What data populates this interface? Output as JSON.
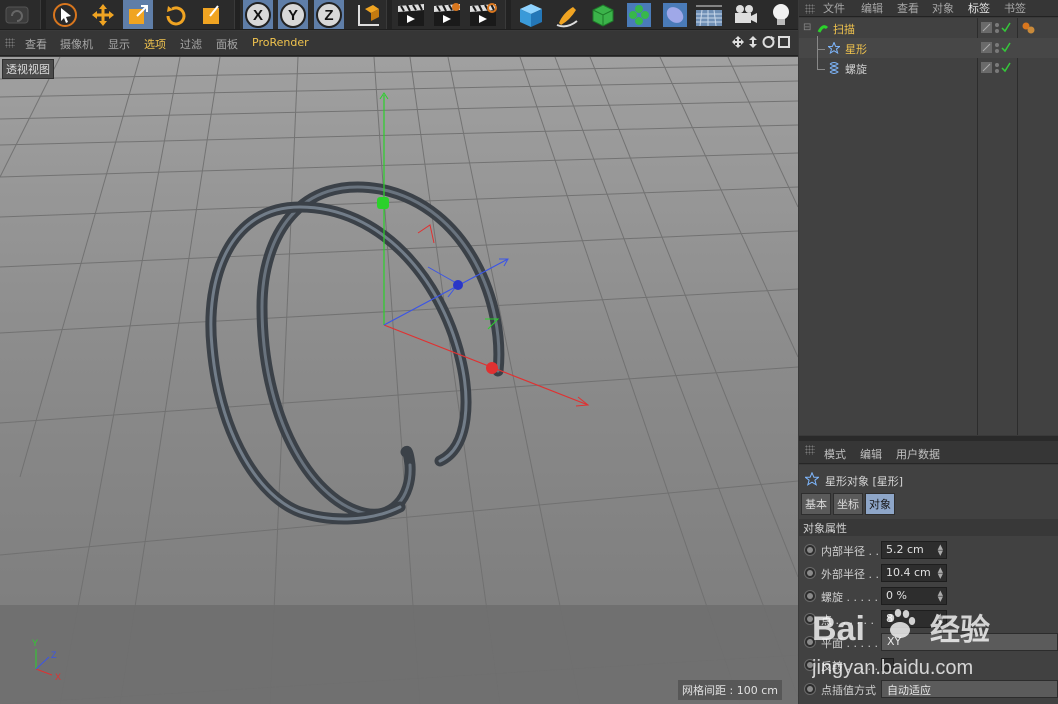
{
  "toolbar": {
    "x_axis": "X",
    "y_axis": "Y",
    "z_axis": "Z"
  },
  "viewport_menu": {
    "items": [
      "查看",
      "摄像机",
      "显示",
      "选项",
      "过滤",
      "面板",
      "ProRender"
    ]
  },
  "viewport": {
    "label": "透视视图",
    "grid_spacing": "网格间距 : 100 cm",
    "axis_y": "Y",
    "axis_z": "Z",
    "axis_x": "X"
  },
  "object_manager": {
    "menu": [
      "文件",
      "编辑",
      "查看",
      "对象",
      "标签",
      "书签"
    ],
    "objects": [
      {
        "name": "扫描"
      },
      {
        "name": "星形"
      },
      {
        "name": "螺旋"
      }
    ]
  },
  "attribute_manager": {
    "menu": [
      "模式",
      "编辑",
      "用户数据"
    ],
    "title": "星形对象 [星形]",
    "tabs": [
      "基本",
      "坐标",
      "对象"
    ],
    "section": "对象属性",
    "props": [
      {
        "label": "内部半径 . .",
        "value": "5.2 cm"
      },
      {
        "label": "外部半径 . .",
        "value": "10.4 cm"
      },
      {
        "label": "螺旋 . . . . .",
        "value": "0 %"
      },
      {
        "label": "点 . . . . . .",
        "value": "8"
      },
      {
        "label": "平面 . . . . .",
        "value": "XY"
      },
      {
        "label": "反转 . . . . .",
        "value": ""
      },
      {
        "label": "点插值方式",
        "value": "自动适应"
      }
    ]
  },
  "watermark": {
    "brand": "Bai",
    "brand2": "经验",
    "url": "jingyan.baidu.com"
  }
}
